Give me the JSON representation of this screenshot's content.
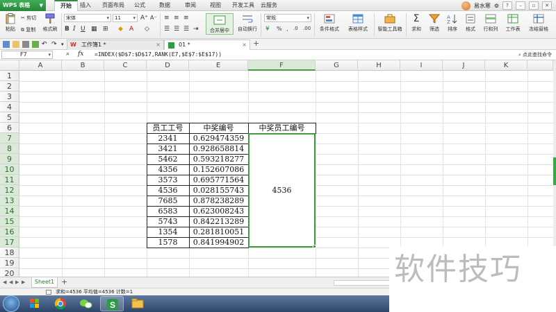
{
  "app": {
    "name": "WPS 表格",
    "menu_tabs": [
      "开始",
      "插入",
      "页面布局",
      "公式",
      "数据",
      "审阅",
      "视图",
      "开发工具",
      "云服务"
    ],
    "active_tab": "开始",
    "user_name": "易水寒"
  },
  "ribbon": {
    "cut": "剪切",
    "copy": "复制",
    "paste": "粘贴",
    "format_painter": "格式刷",
    "font_name": "宋体",
    "font_size": "11",
    "merge_center": "合并居中",
    "wrap_text": "自动换行",
    "number_format": "常规",
    "conditional_format": "条件格式",
    "table_style": "表格样式",
    "smart_toolbox": "智能工具箱",
    "sum": "求和",
    "filter": "筛选",
    "sort": "排序",
    "format": "格式",
    "rows_cols": "行和列",
    "worksheet": "工作表",
    "freeze_panes": "冻结窗格"
  },
  "doc_tabs": [
    {
      "label": "工作簿1 *",
      "active": false
    },
    {
      "label": "01 *",
      "active": true
    }
  ],
  "formula_bar": {
    "name_box": "F7",
    "fx": "fx",
    "formula": "=INDEX($D$7:$D$17,RANK(E7,$E$7:$E$17))",
    "hint": "点此查找命令"
  },
  "grid": {
    "columns": [
      "A",
      "B",
      "C",
      "D",
      "E",
      "F",
      "G",
      "H",
      "I",
      "J",
      "K"
    ],
    "rows": [
      "1",
      "2",
      "3",
      "4",
      "5",
      "6",
      "7",
      "8",
      "9",
      "10",
      "11",
      "12",
      "13",
      "14",
      "15",
      "16",
      "17",
      "18",
      "19",
      "20"
    ],
    "selected_column": "F",
    "header": {
      "employee_id": "员工工号",
      "winning_no": "中奖编号",
      "winner_id": "中奖员工编号"
    },
    "employee_ids": [
      "2341",
      "3421",
      "5462",
      "4356",
      "3573",
      "4536",
      "7685",
      "6583",
      "5743",
      "1354",
      "1578"
    ],
    "winning_numbers": [
      "0.629474359",
      "0.928658814",
      "0.593218277",
      "0.152607086",
      "0.695771564",
      "0.028155743",
      "0.878238289",
      "0.623008243",
      "0.842213289",
      "0.281810051",
      "0.841994902"
    ],
    "result": "4536"
  },
  "sheet_tabs": [
    "Sheet1"
  ],
  "status": {
    "text": "求和=4536  平均值=4536  计数=1"
  },
  "watermark": "软件技巧",
  "colors": {
    "accent_green": "#3e9b3e",
    "app_green": "#27873a"
  }
}
